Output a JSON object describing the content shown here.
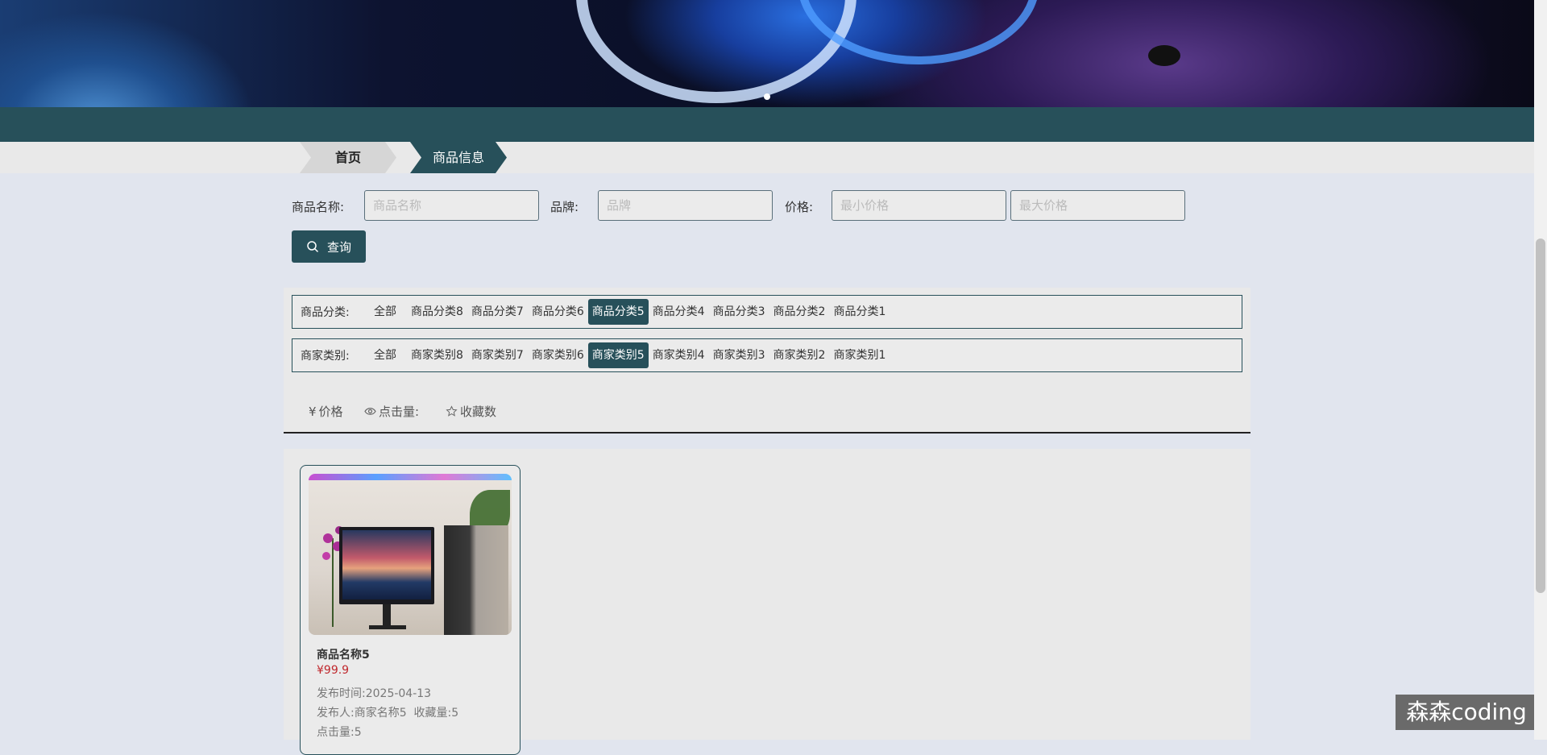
{
  "breadcrumb": {
    "home": "首页",
    "current": "商品信息"
  },
  "search": {
    "name_label": "商品名称:",
    "name_placeholder": "商品名称",
    "brand_label": "品牌:",
    "brand_placeholder": "品牌",
    "price_label": "价格:",
    "min_price_placeholder": "最小价格",
    "max_price_placeholder": "最大价格",
    "button_label": "查询"
  },
  "filters": {
    "category": {
      "label": "商品分类:",
      "options": [
        "全部",
        "商品分类8",
        "商品分类7",
        "商品分类6",
        "商品分类5",
        "商品分类4",
        "商品分类3",
        "商品分类2",
        "商品分类1"
      ],
      "selected": "商品分类5"
    },
    "merchant": {
      "label": "商家类别:",
      "options": [
        "全部",
        "商家类别8",
        "商家类别7",
        "商家类别6",
        "商家类别5",
        "商家类别4",
        "商家类别3",
        "商家类别2",
        "商家类别1"
      ],
      "selected": "商家类别5"
    }
  },
  "sort": {
    "price": "价格",
    "price_icon": "¥",
    "clicks": "点击量:",
    "favorites": "收藏数"
  },
  "products": [
    {
      "name": "商品名称5",
      "price": "¥99.9",
      "publish_time": "发布时间:2025-04-13",
      "publisher_and_fav": "发布人:商家名称5  收藏量:5",
      "clicks": "点击量:5"
    }
  ],
  "watermark": "森森coding",
  "colors": {
    "accent": "#27505a",
    "price": "#c0282d",
    "page_bg": "#e1e5ee"
  }
}
